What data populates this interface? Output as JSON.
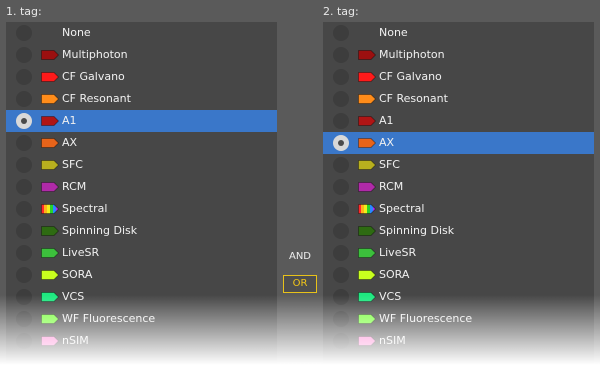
{
  "panels": [
    {
      "label": "1. tag:",
      "selected": 4,
      "items": [
        {
          "label": "None",
          "color": null
        },
        {
          "label": "Multiphoton",
          "color": "#9b1010"
        },
        {
          "label": "CF Galvano",
          "color": "#ff1a1a"
        },
        {
          "label": "CF Resonant",
          "color": "#ff8c1a"
        },
        {
          "label": "A1",
          "color": "#b01515"
        },
        {
          "label": "AX",
          "color": "#e8641a"
        },
        {
          "label": "SFC",
          "color": "#b8b01e"
        },
        {
          "label": "RCM",
          "color": "#b02aa8"
        },
        {
          "label": "Spectral",
          "color": "rainbow"
        },
        {
          "label": "Spinning Disk",
          "color": "#2e6b12"
        },
        {
          "label": "LiveSR",
          "color": "#3cc03c"
        },
        {
          "label": "SORA",
          "color": "#c8ff1e"
        },
        {
          "label": "VCS",
          "color": "#1ee880"
        },
        {
          "label": "WF Fluorescence",
          "color": "#7aff3c"
        },
        {
          "label": "nSIM",
          "color": "#ff7ad0"
        }
      ]
    },
    {
      "label": "2. tag:",
      "selected": 5,
      "items": [
        {
          "label": "None",
          "color": null
        },
        {
          "label": "Multiphoton",
          "color": "#9b1010"
        },
        {
          "label": "CF Galvano",
          "color": "#ff1a1a"
        },
        {
          "label": "CF Resonant",
          "color": "#ff8c1a"
        },
        {
          "label": "A1",
          "color": "#b01515"
        },
        {
          "label": "AX",
          "color": "#e8641a"
        },
        {
          "label": "SFC",
          "color": "#b8b01e"
        },
        {
          "label": "RCM",
          "color": "#b02aa8"
        },
        {
          "label": "Spectral",
          "color": "rainbow"
        },
        {
          "label": "Spinning Disk",
          "color": "#2e6b12"
        },
        {
          "label": "LiveSR",
          "color": "#3cc03c"
        },
        {
          "label": "SORA",
          "color": "#c8ff1e"
        },
        {
          "label": "VCS",
          "color": "#1ee880"
        },
        {
          "label": "WF Fluorescence",
          "color": "#7aff3c"
        },
        {
          "label": "nSIM",
          "color": "#ff7ad0"
        }
      ]
    }
  ],
  "operators": {
    "and_label": "AND",
    "or_label": "OR",
    "active": "OR",
    "active_color": "#f0c419"
  },
  "colors": {
    "background": "#5a5a5a",
    "list_background": "#474747",
    "selection": "#3a77c9"
  }
}
